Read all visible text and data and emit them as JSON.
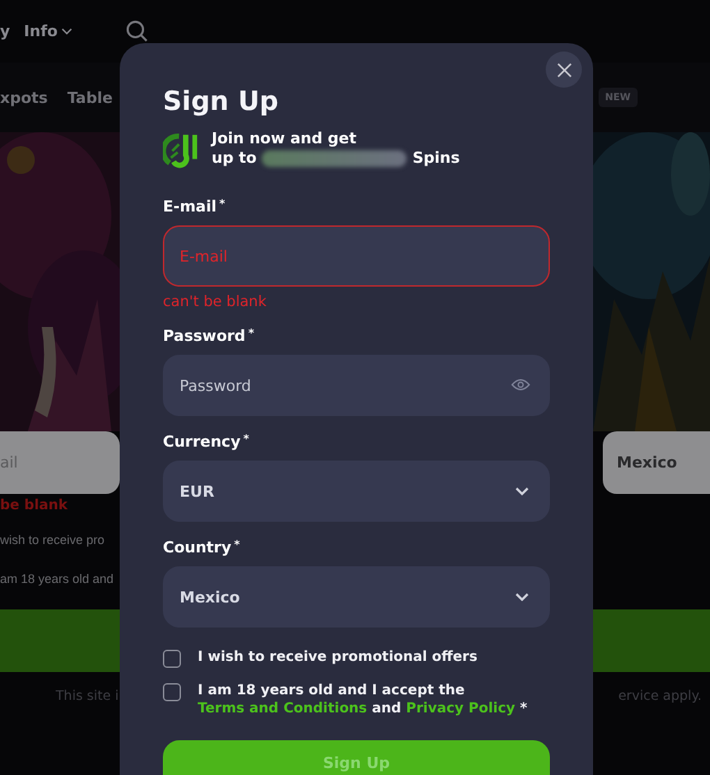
{
  "nav": {
    "items": [
      {
        "label": "y",
        "dropdown": false
      },
      {
        "label": "Info",
        "dropdown": true
      }
    ]
  },
  "categories": [
    {
      "label": "xpots"
    },
    {
      "label": "Table"
    }
  ],
  "new_badge": "NEW",
  "background_form": {
    "email_value": "ail",
    "error": "be blank",
    "country": "Mexico",
    "checkbox_texts": [
      "wish to receive pro",
      "am 18 years old and"
    ],
    "footer_left": "This site i",
    "footer_right": "ervice apply."
  },
  "modal": {
    "title": "Sign Up",
    "promo": {
      "line1": "Join now and get",
      "line2_prefix": "up to",
      "line2_suffix": "Spins"
    },
    "fields": [
      {
        "kind": "text",
        "label": "E-mail",
        "required_mark": "*",
        "placeholder": "E-mail",
        "error": "can't be blank"
      },
      {
        "kind": "password",
        "label": "Password",
        "required_mark": "*",
        "placeholder": "Password"
      },
      {
        "kind": "select",
        "label": "Currency",
        "required_mark": "*",
        "value": "EUR"
      },
      {
        "kind": "select",
        "label": "Country",
        "required_mark": "*",
        "value": "Mexico"
      }
    ],
    "checkboxes": [
      {
        "checked": false,
        "parts": [
          {
            "text": "I wish to receive promotional offers",
            "link": false
          }
        ]
      },
      {
        "checked": false,
        "parts": [
          {
            "text": "I am 18 years old and I accept the ",
            "link": false
          },
          {
            "text": "Terms and Conditions",
            "link": true
          },
          {
            "text": " and ",
            "link": false
          },
          {
            "text": "Privacy Policy",
            "link": true
          },
          {
            "text": " *",
            "link": false
          }
        ]
      }
    ],
    "submit": "Sign Up"
  }
}
